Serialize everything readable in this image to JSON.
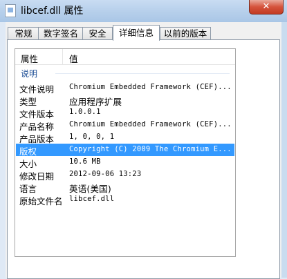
{
  "window": {
    "title": "libcef.dll 属性",
    "close_glyph": "✕"
  },
  "tabs": [
    "常规",
    "数字签名",
    "安全",
    "详细信息",
    "以前的版本"
  ],
  "active_tab": "详细信息",
  "list": {
    "col_property": "属性",
    "col_value": "值",
    "group": "说明",
    "rows": [
      {
        "key": "文件说明",
        "value": "Chromium Embedded Framework (CEF)..."
      },
      {
        "key": "类型",
        "value": "应用程序扩展"
      },
      {
        "key": "文件版本",
        "value": "1.0.0.1"
      },
      {
        "key": "产品名称",
        "value": "Chromium Embedded Framework (CEF)..."
      },
      {
        "key": "产品版本",
        "value": "1, 0, 0, 1"
      },
      {
        "key": "版权",
        "value": "Copyright (C) 2009 The Chromium E..."
      },
      {
        "key": "大小",
        "value": "10.6 MB"
      },
      {
        "key": "修改日期",
        "value": "2012-09-06 13:23"
      },
      {
        "key": "语言",
        "value": "英语(美国)"
      },
      {
        "key": "原始文件名",
        "value": "libcef.dll"
      }
    ],
    "selected": "版权"
  }
}
